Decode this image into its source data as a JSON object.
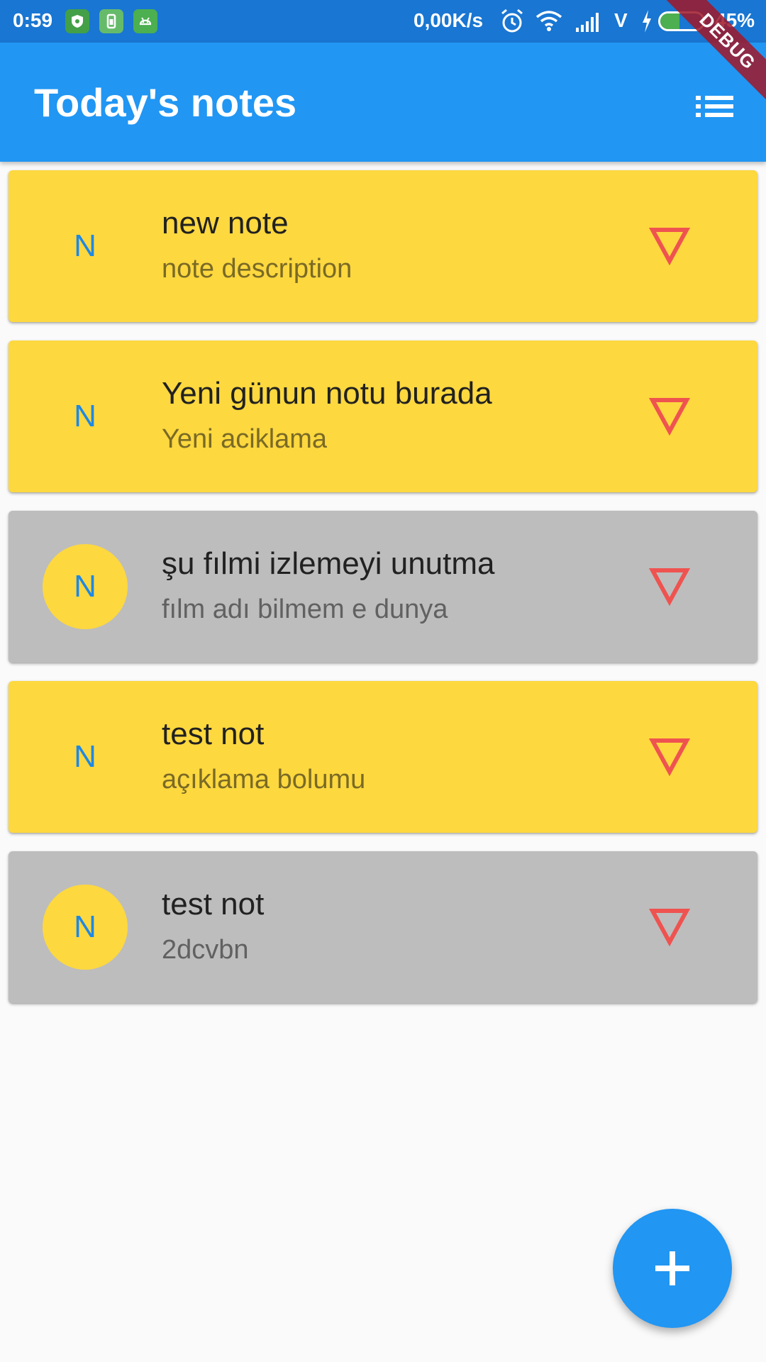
{
  "status_bar": {
    "time": "0:59",
    "network_speed": "0,00K/s",
    "carrier_letter": "V",
    "battery_percent": "45%",
    "battery_level": 0.45,
    "icons": [
      "shield-app-icon",
      "phone-app-icon",
      "android-app-icon",
      "alarm-icon",
      "wifi-icon",
      "signal-icon",
      "charging-icon",
      "battery-icon"
    ]
  },
  "app_bar": {
    "title": "Today's notes",
    "menu_icon": "list-icon"
  },
  "debug_banner": "DEBUG",
  "notes": [
    {
      "avatar": "N",
      "title": "new note",
      "description": "note description",
      "color": "yellow",
      "action_icon": "triangle-down-icon"
    },
    {
      "avatar": "N",
      "title": "Yeni günun notu burada",
      "description": "Yeni aciklama",
      "color": "yellow",
      "action_icon": "triangle-down-icon"
    },
    {
      "avatar": "N",
      "title": "şu fılmi izlemeyi unutma",
      "description": "fılm adı bilmem e dunya",
      "color": "grey",
      "action_icon": "triangle-down-icon"
    },
    {
      "avatar": "N",
      "title": "test not",
      "description": "açıklama bolumu",
      "color": "yellow",
      "action_icon": "triangle-down-icon"
    },
    {
      "avatar": "N",
      "title": "test not",
      "description": "2dcvbn",
      "color": "grey",
      "action_icon": "triangle-down-icon"
    }
  ],
  "fab": {
    "icon": "plus-icon"
  },
  "colors": {
    "status_bar": "#1976d2",
    "app_bar": "#2196f3",
    "note_yellow": "#fdd83f",
    "note_grey": "#bdbdbd",
    "avatar_text": "#1e88e5",
    "action_icon": "#ef5350",
    "fab": "#2196f3",
    "background": "#fafafa"
  }
}
